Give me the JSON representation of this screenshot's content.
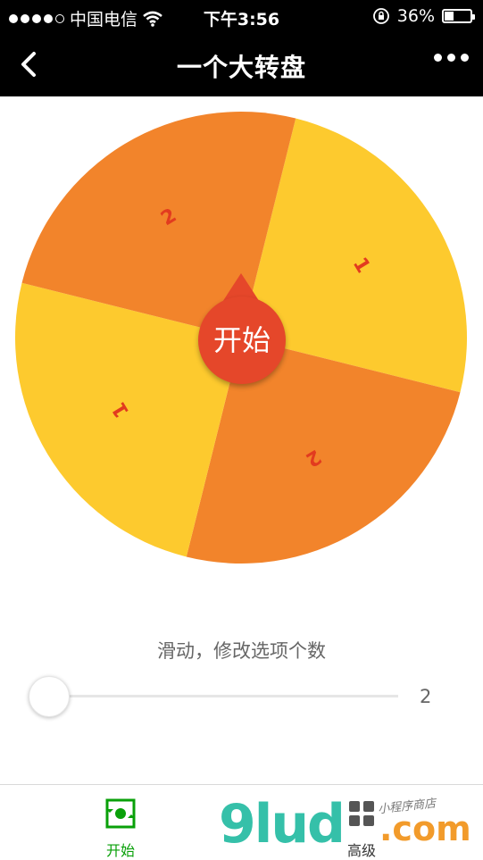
{
  "status_bar": {
    "carrier": "中国电信",
    "time": "下午3:56",
    "battery": "36%",
    "battery_level": 0.36
  },
  "nav": {
    "title": "一个大转盘"
  },
  "wheel": {
    "segments": [
      {
        "label": "1",
        "color": "#fdca2e"
      },
      {
        "label": "2",
        "color": "#f2842b"
      },
      {
        "label": "1",
        "color": "#fdca2e"
      },
      {
        "label": "2",
        "color": "#f2842b"
      }
    ],
    "start_label": "开始",
    "start_color": "#e5472a"
  },
  "slider": {
    "label": "滑动，修改选项个数",
    "value": "2",
    "position": 0.0
  },
  "tabs": [
    {
      "label": "开始",
      "active": true,
      "color": "#09a009"
    },
    {
      "label": "高级",
      "active": false,
      "color": "#333333"
    }
  ],
  "watermark": {
    "main": "9lud",
    "suffix": ".com",
    "tagline": "小程序商店"
  }
}
